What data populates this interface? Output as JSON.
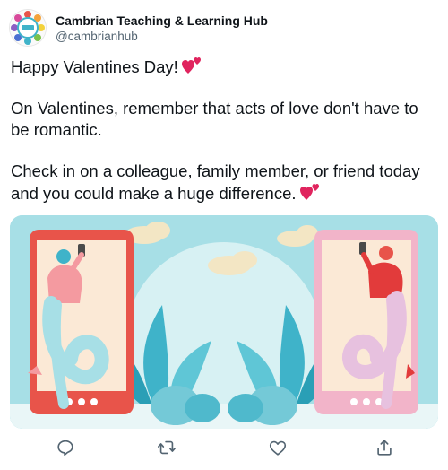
{
  "account": {
    "display_name": "Cambrian Teaching & Learning Hub",
    "handle": "@cambrianhub",
    "avatar_icon": "cambrian-logo-icon"
  },
  "tweet": {
    "paragraphs": [
      "Happy Valentines Day!",
      "On Valentines, remember that acts of love don't have to be romantic.",
      "Check in on a colleague, family member, or friend today and you could make a huge difference."
    ],
    "emoji": "two-hearts-icon"
  },
  "media": {
    "description_icon": "valentines-phone-illustration",
    "colors": {
      "background": "#a7dfe6",
      "left_phone": "#e8544a",
      "right_phone": "#f2b4c9",
      "sky_circle": "#d7f1f3",
      "plants": "#3fb3c9"
    }
  },
  "actions": [
    {
      "name": "reply",
      "icon": "reply-icon"
    },
    {
      "name": "retweet",
      "icon": "retweet-icon"
    },
    {
      "name": "like",
      "icon": "like-icon"
    },
    {
      "name": "share",
      "icon": "share-icon"
    }
  ],
  "colors": {
    "text_primary": "#0f1419",
    "text_secondary": "#536471",
    "heart": "#e0245e"
  }
}
